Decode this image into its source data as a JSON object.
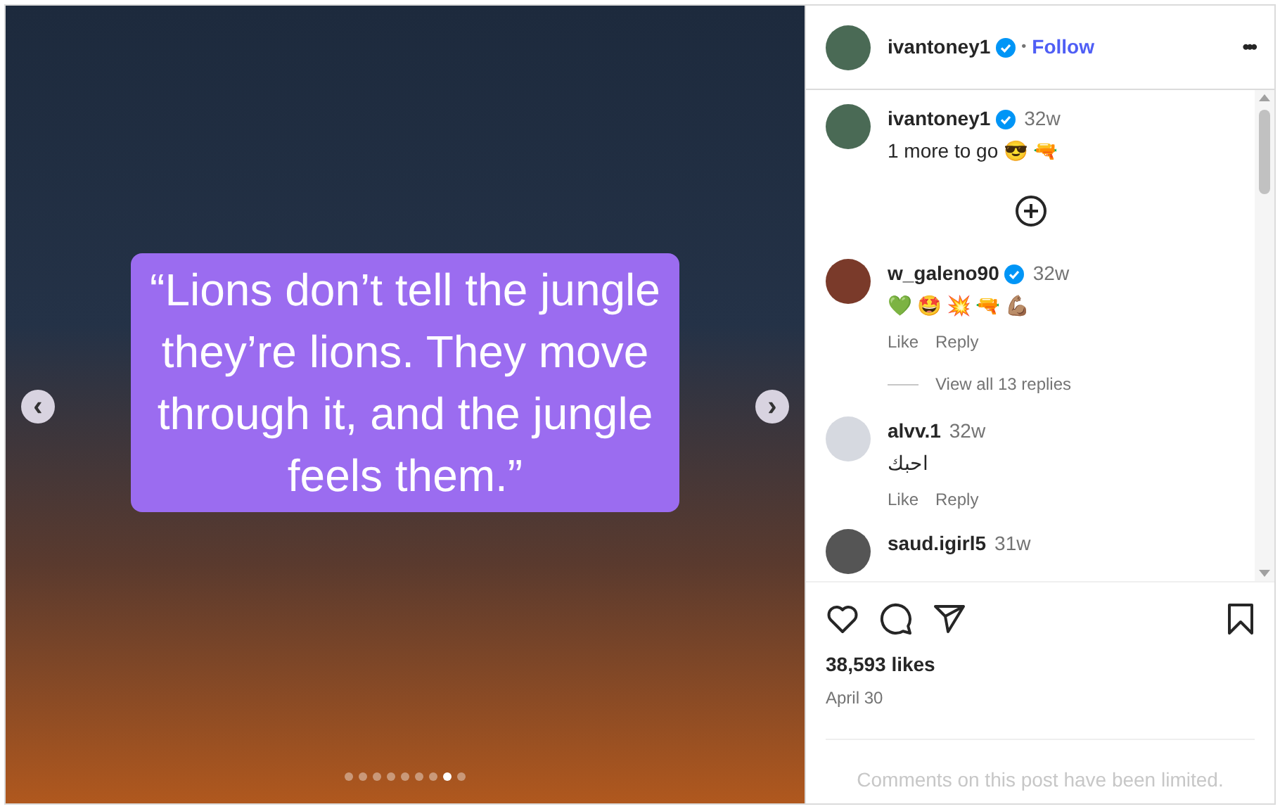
{
  "post_image": {
    "quote": "“Lions don’t tell the jungle they’re lions. They move through it, and the jungle feels them.”",
    "prev_arrow": "‹",
    "next_arrow": "›",
    "dots": [
      {
        "selected": false
      },
      {
        "selected": false
      },
      {
        "selected": false
      },
      {
        "selected": false
      },
      {
        "selected": false
      },
      {
        "selected": false
      },
      {
        "selected": false
      },
      {
        "selected": true
      },
      {
        "selected": false
      }
    ]
  },
  "header": {
    "username": "ivantoney1",
    "verified": true,
    "separator": "•",
    "follow": "Follow",
    "more": "•••"
  },
  "comments": [
    {
      "username": "ivantoney1",
      "verified": true,
      "time": "32w",
      "text": "1 more to go 😎 🔫",
      "kind": "caption"
    },
    {
      "username": "w_galeno90",
      "verified": true,
      "time": "32w",
      "text": "💚 🤩 💥 🔫 💪🏽",
      "kind": "comment",
      "like": "Like",
      "reply": "Reply",
      "view_replies": "View all 13 replies"
    },
    {
      "username": "alvv.1",
      "verified": false,
      "time": "32w",
      "text": "احبك",
      "kind": "comment",
      "like": "Like",
      "reply": "Reply"
    },
    {
      "username": "saud.igirl5",
      "verified": false,
      "time": "31w",
      "kind": "comment"
    }
  ],
  "likes": "38,593 likes",
  "date": "April 30",
  "limited_notice": "Comments on this post have been limited."
}
